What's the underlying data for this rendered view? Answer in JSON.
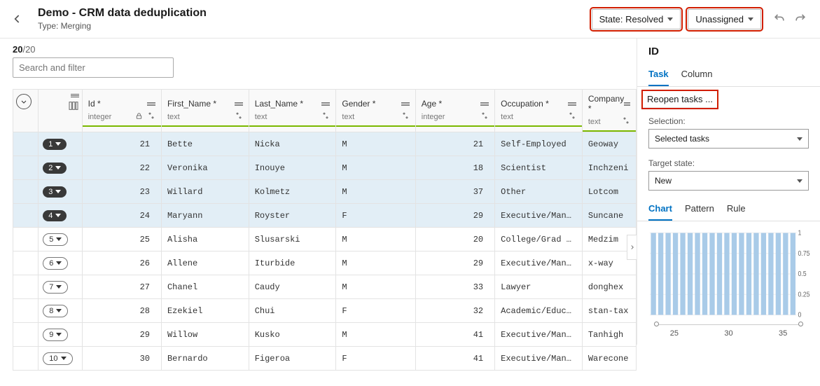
{
  "header": {
    "title": "Demo - CRM data deduplication",
    "subtitle": "Type: Merging",
    "state_dropdown": "State: Resolved",
    "assign_dropdown": "Unassigned"
  },
  "counter": {
    "current": "20",
    "total": "/20"
  },
  "search": {
    "placeholder": "Search and filter"
  },
  "columns": [
    {
      "key": "id",
      "label": "Id *",
      "type_label": "integer",
      "lock": true
    },
    {
      "key": "first_name",
      "label": "First_Name *",
      "type_label": "text",
      "lock": false
    },
    {
      "key": "last_name",
      "label": "Last_Name *",
      "type_label": "text",
      "lock": false
    },
    {
      "key": "gender",
      "label": "Gender *",
      "type_label": "text",
      "lock": false
    },
    {
      "key": "age",
      "label": "Age *",
      "type_label": "integer",
      "lock": false
    },
    {
      "key": "occupation",
      "label": "Occupation *",
      "type_label": "text",
      "lock": false
    },
    {
      "key": "company",
      "label": "Company *",
      "type_label": "text",
      "lock": false
    }
  ],
  "rows": [
    {
      "n": 1,
      "sel": true,
      "id": 21,
      "first_name": "Bette",
      "last_name": "Nicka",
      "gender": "M",
      "age": 21,
      "occupation": "Self-Employed",
      "company": "Geoway"
    },
    {
      "n": 2,
      "sel": true,
      "id": 22,
      "first_name": "Veronika",
      "last_name": "Inouye",
      "gender": "M",
      "age": 18,
      "occupation": "Scientist",
      "company": "Inchzeni"
    },
    {
      "n": 3,
      "sel": true,
      "id": 23,
      "first_name": "Willard",
      "last_name": "Kolmetz",
      "gender": "M",
      "age": 37,
      "occupation": "Other",
      "company": "Lotcom"
    },
    {
      "n": 4,
      "sel": true,
      "id": 24,
      "first_name": "Maryann",
      "last_name": "Royster",
      "gender": "F",
      "age": 29,
      "occupation": "Executive/Man...",
      "company": "Suncane"
    },
    {
      "n": 5,
      "sel": false,
      "id": 25,
      "first_name": "Alisha",
      "last_name": "Slusarski",
      "gender": "M",
      "age": 20,
      "occupation": "College/Grad ...",
      "company": "Medzim"
    },
    {
      "n": 6,
      "sel": false,
      "id": 26,
      "first_name": "Allene",
      "last_name": "Iturbide",
      "gender": "M",
      "age": 29,
      "occupation": "Executive/Man...",
      "company": "x-way"
    },
    {
      "n": 7,
      "sel": false,
      "id": 27,
      "first_name": "Chanel",
      "last_name": "Caudy",
      "gender": "M",
      "age": 33,
      "occupation": "Lawyer",
      "company": "donghex"
    },
    {
      "n": 8,
      "sel": false,
      "id": 28,
      "first_name": "Ezekiel",
      "last_name": "Chui",
      "gender": "F",
      "age": 32,
      "occupation": "Academic/Educ...",
      "company": "stan-tax"
    },
    {
      "n": 9,
      "sel": false,
      "id": 29,
      "first_name": "Willow",
      "last_name": "Kusko",
      "gender": "M",
      "age": 41,
      "occupation": "Executive/Man...",
      "company": "Tanhigh"
    },
    {
      "n": 10,
      "sel": false,
      "id": 30,
      "first_name": "Bernardo",
      "last_name": "Figeroa",
      "gender": "F",
      "age": 41,
      "occupation": "Executive/Man...",
      "company": "Warecone"
    }
  ],
  "sidepanel": {
    "header": "ID",
    "tabs": {
      "task": "Task",
      "column": "Column"
    },
    "reopen_label": "Reopen tasks ...",
    "selection_label": "Selection:",
    "selection_value": "Selected tasks",
    "target_label": "Target state:",
    "target_value": "New",
    "mini_tabs": {
      "chart": "Chart",
      "pattern": "Pattern",
      "rule": "Rule"
    },
    "chart_x_ticks": [
      "25",
      "30",
      "35"
    ]
  },
  "chart_data": {
    "type": "bar",
    "xlabel": "",
    "ylabel": "",
    "ylim": [
      0,
      1
    ],
    "y_ticks": [
      0,
      0.25,
      0.5,
      0.75,
      1
    ],
    "x_range": [
      21,
      40
    ],
    "values": [
      1,
      1,
      1,
      1,
      1,
      1,
      1,
      1,
      1,
      1,
      1,
      1,
      1,
      1,
      1,
      1,
      1,
      1,
      1,
      1
    ]
  }
}
